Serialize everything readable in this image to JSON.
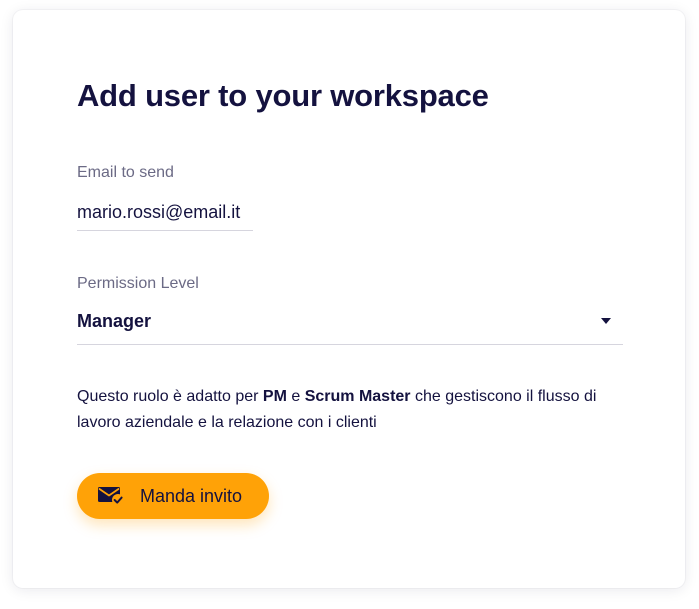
{
  "dialog": {
    "title": "Add user to your workspace",
    "email": {
      "label": "Email to send",
      "value": "mario.rossi@email.it"
    },
    "permission": {
      "label": "Permission Level",
      "selected": "Manager"
    },
    "description": {
      "text_1": "Questo ruolo è adatto per ",
      "bold_1": "PM",
      "text_2": " e ",
      "bold_2": "Scrum Master",
      "text_3": " che gestiscono il flusso di lavoro aziendale e la relazione con i clienti"
    },
    "invite_button": {
      "label": "Manda invito",
      "icon": "mail-check-icon"
    }
  },
  "colors": {
    "text_dark": "#14123f",
    "text_muted": "#6b6a85",
    "accent": "#ffa207",
    "underline": "#d6d5de"
  }
}
